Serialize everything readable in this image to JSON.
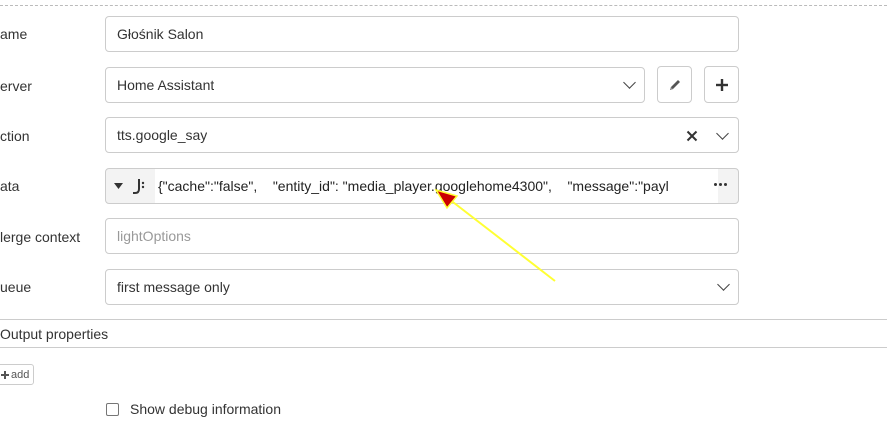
{
  "fields": {
    "name": {
      "label": "ame",
      "value": "Głośnik Salon"
    },
    "server": {
      "label": "erver",
      "value": "Home Assistant"
    },
    "action": {
      "label": "ction",
      "value": "tts.google_say"
    },
    "data": {
      "label": "ata",
      "value": "{\"cache\":\"false\",    \"entity_id\": \"media_player.googlehome4300\",    \"message\":\"payl"
    },
    "merge_context": {
      "label": "lerge context",
      "placeholder": "lightOptions"
    },
    "queue": {
      "label": "ueue",
      "value": "first message only"
    }
  },
  "output": {
    "section_title": "Output properties",
    "add_label": "add"
  },
  "debug": {
    "label": "Show debug information",
    "checked": false
  },
  "icons": {
    "edit": "pencil-icon",
    "add": "plus-icon",
    "clear": "close-icon",
    "type_toggle": "caret-down-icon",
    "jsonata": "jsonata-icon",
    "expand": "ellipsis-icon",
    "annotation": "yellow-arrow"
  },
  "colors": {
    "annotation": "#ffff33",
    "arrowhead": "#cc0000",
    "border": "#cccccc"
  }
}
